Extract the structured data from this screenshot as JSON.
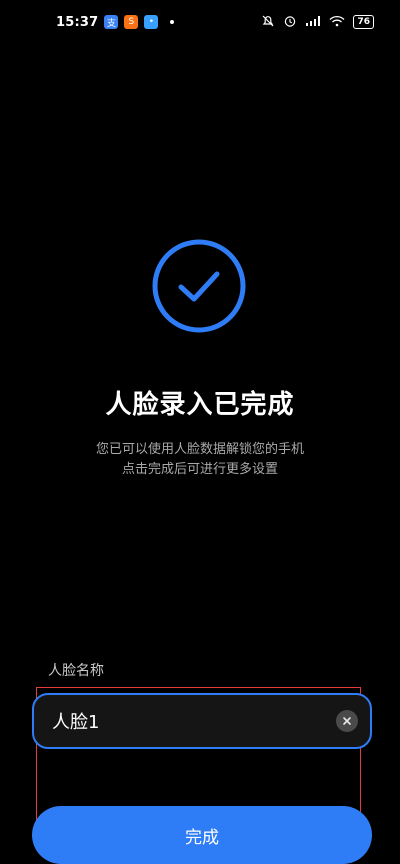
{
  "status_bar": {
    "time": "15:37",
    "app_badges": [
      "支",
      "S",
      "•"
    ],
    "icons": [
      "mute-icon",
      "alarm-icon",
      "signal-icon",
      "wifi-icon"
    ],
    "battery": "76"
  },
  "success": {
    "icon": "check-circle-icon",
    "title": "人脸录入已完成",
    "subtitle_line1": "您已可以使用人脸数据解锁您的手机",
    "subtitle_line2": "点击完成后可进行更多设置"
  },
  "face_name": {
    "label": "人脸名称",
    "value": "人脸1",
    "clear_icon": "close-icon"
  },
  "actions": {
    "done_label": "完成"
  },
  "colors": {
    "accent": "#2f7df6",
    "background": "#000000",
    "outline_red": "#e23b3b"
  }
}
